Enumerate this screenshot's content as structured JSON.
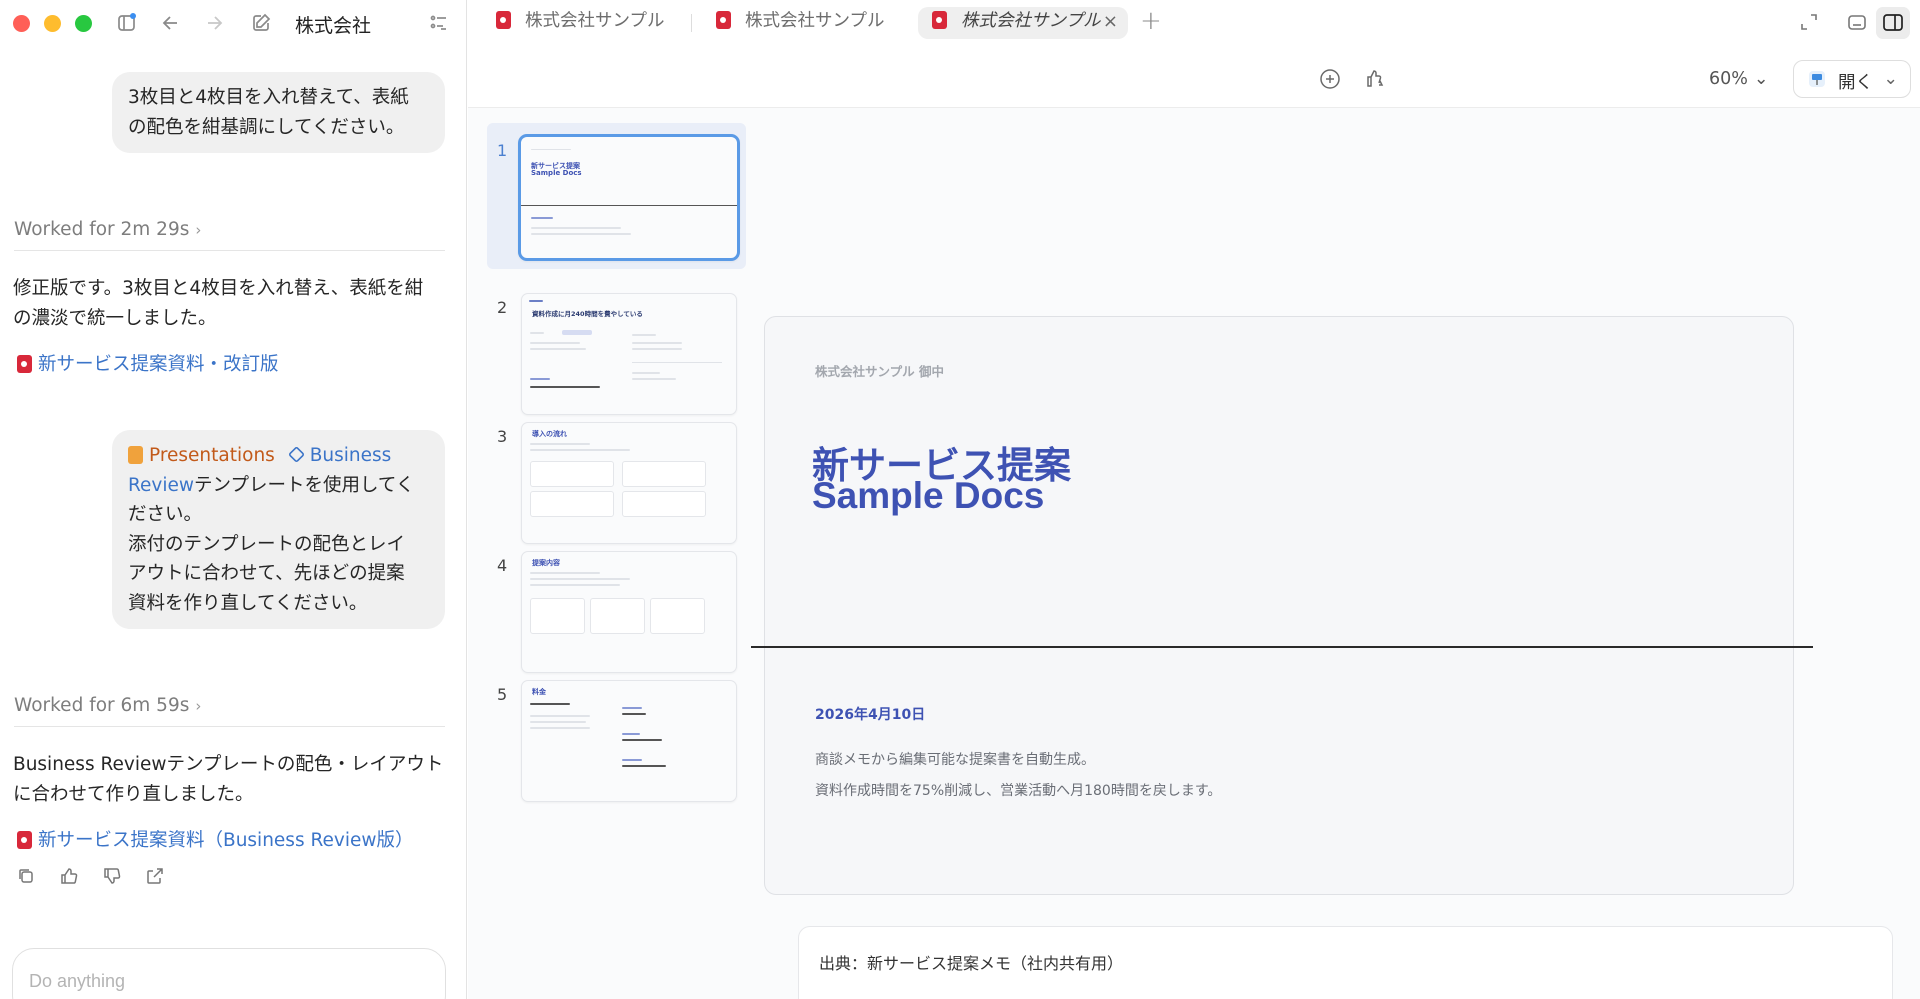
{
  "sidebar": {
    "chat_title": "株式会社",
    "messages": {
      "user1": [
        "3枚目と4枚目を入れ替えて、表紙",
        "の配色を紺基調にしてください。"
      ],
      "worked1": "Worked for 2m 29s",
      "answer1": [
        "修正版です。3枚目と4枚目を入れ替え、表紙を紺",
        "の濃淡で統一しました。"
      ],
      "link1": "新サービス提案資料・改訂版",
      "user2": {
        "tag_presentations": "Presentations",
        "tag_business": "Business",
        "line1_rest": "Review",
        "line1_after": "テンプレートを使用してく",
        "lines": [
          "ださい。",
          "添付のテンプレートの配色とレイ",
          "アウトに合わせて、先ほどの提案",
          "資料を作り直してください。"
        ]
      },
      "worked2": "Worked for 6m 59s",
      "answer2": [
        "Business Reviewテンプレートの配色・レイアウト",
        "に合わせて作り直しました。"
      ],
      "link2": "新サービス提案資料（Business Review版）"
    },
    "composer_placeholder": "Do anything"
  },
  "tabs": [
    {
      "label": "株式会社サンプル"
    },
    {
      "label": "株式会社サンプル"
    },
    {
      "label": "株式会社サンプル"
    }
  ],
  "toolbar": {
    "zoom": "60%",
    "open_label": "開く"
  },
  "thumbnails": {
    "numbers": [
      "1",
      "2",
      "3",
      "4",
      "5"
    ],
    "titles": [
      "新サービス提案",
      "資料作成に月240時間を費やしている",
      "導入の流れ",
      "提案内容",
      "料金"
    ],
    "t1_sub": "Sample Docs"
  },
  "slide": {
    "client": "株式会社サンプル 御中",
    "title_line1": "新サービス提案",
    "title_line2": "Sample Docs",
    "date": "2026年4月10日",
    "body1": "商談メモから編集可能な提案書を自動生成。",
    "body2": "資料作成時間を75%削減し、営業活動へ月180時間を戻します。"
  },
  "source": "出典：新サービス提案メモ（社内共有用）"
}
